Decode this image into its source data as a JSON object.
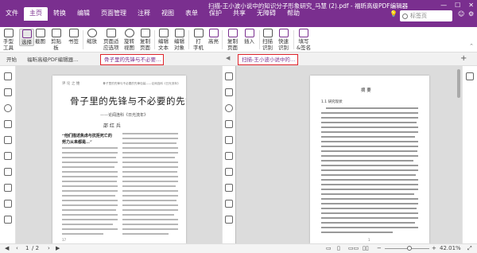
{
  "app": {
    "title": "扫描-王小波小说中的知识分子形象研究_马慧 (2).pdf - 福昕高级PDF编辑器",
    "window_controls": [
      "—",
      "☐",
      "✕"
    ]
  },
  "menu": [
    "文件",
    "主页",
    "转换",
    "编辑",
    "页面管理",
    "注释",
    "视图",
    "表单",
    "保护",
    "共享",
    "无障碍",
    "帮助"
  ],
  "active_menu_index": 1,
  "search": {
    "placeholder": "标签页"
  },
  "ribbon": {
    "tools": [
      "手型\n工具",
      "选择",
      "截图",
      "剪贴\n板",
      "书签",
      "缩放",
      "页面适\n应选项",
      "旋转\n视图",
      "复制\n页面",
      "编辑\n文本",
      "编辑\n对象",
      "打\n字机",
      "高亮",
      "复制\n页面",
      "插入",
      "扫描\n识别",
      "快速\n识别",
      "填写\n&签名"
    ]
  },
  "tabs": {
    "start": "开始",
    "items": [
      {
        "label": "福昕高级PDF编辑器…"
      },
      {
        "label": "骨子里的先锋与不必要…"
      },
      {
        "label": "扫描-王小波小说中的…"
      }
    ],
    "close": "✕",
    "add": "+"
  },
  "left_doc": {
    "header_left": "评 论 之 维",
    "header_right": "骨子里的先锋与不必要的先锋包装——论阎连科《日光流年》",
    "title": "骨子里的先锋与不必要的先锋包装",
    "subtitle": "——论阎连科《日光流年》",
    "author": "邵 红 兵",
    "highlight_1": "“他们描述焦虑与抗拒死亡的",
    "highlight_2": "努力从来都是…”",
    "page_number": "17"
  },
  "right_doc": {
    "title": "摘 要",
    "section": "1.1 研究现状",
    "page_number": "1"
  },
  "statusbar": {
    "page_current": "1",
    "page_total": "/ 2",
    "zoom": "42.01%",
    "zoom_fraction": 0.55
  }
}
